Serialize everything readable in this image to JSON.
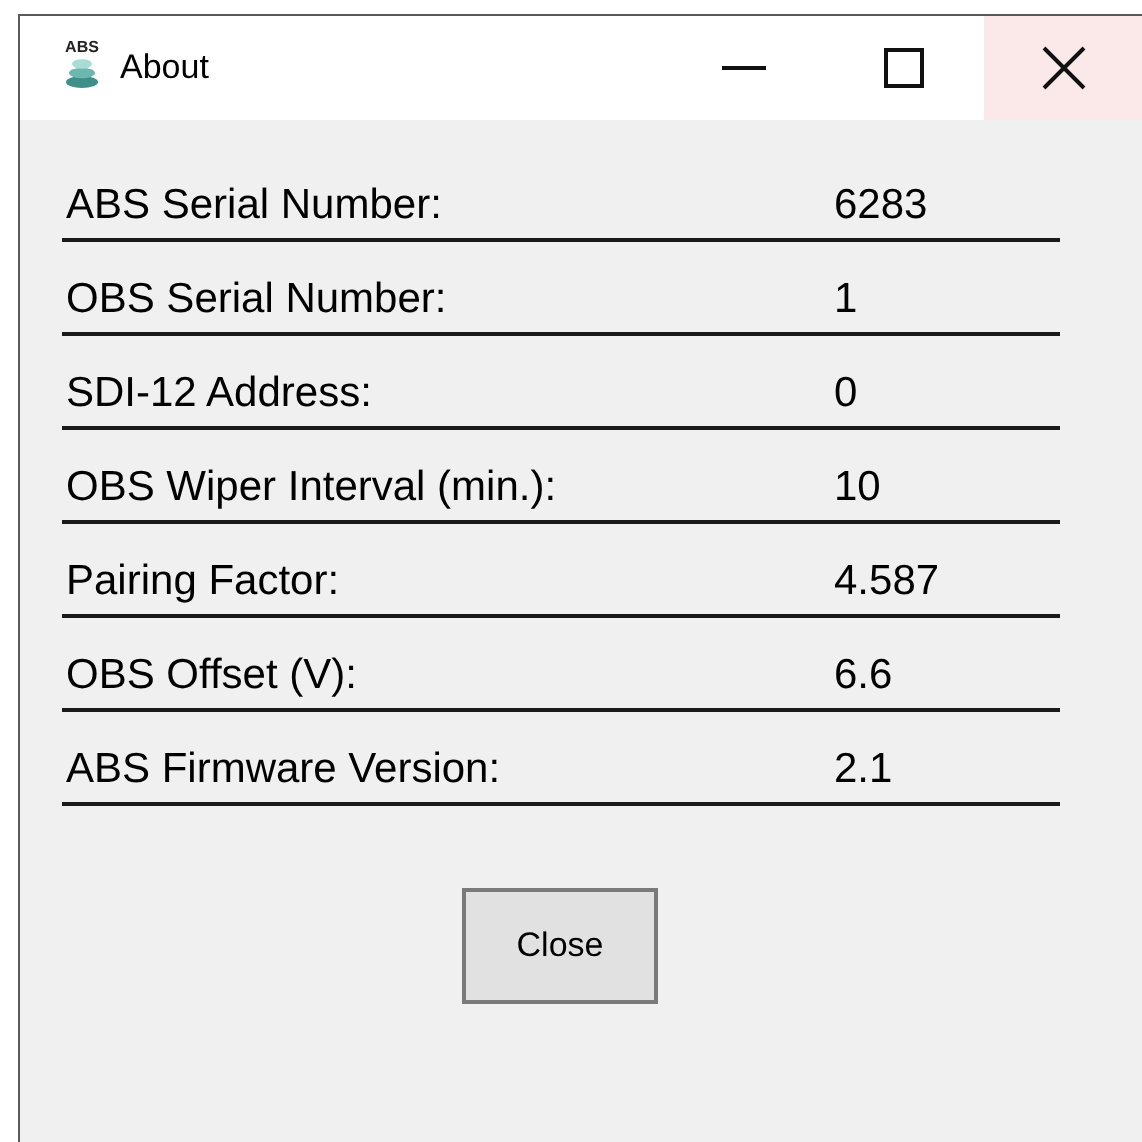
{
  "window": {
    "title": "About",
    "icon_label": "ABS"
  },
  "rows": [
    {
      "label": "ABS Serial Number:",
      "value": "6283"
    },
    {
      "label": "OBS Serial Number:",
      "value": "1"
    },
    {
      "label": "SDI-12 Address:",
      "value": "0"
    },
    {
      "label": "OBS Wiper Interval (min.):",
      "value": "10"
    },
    {
      "label": "Pairing Factor:",
      "value": "4.587"
    },
    {
      "label": "OBS Offset (V):",
      "value": "6.6"
    },
    {
      "label": "ABS Firmware Version:",
      "value": "2.1"
    }
  ],
  "buttons": [
    "Close"
  ]
}
